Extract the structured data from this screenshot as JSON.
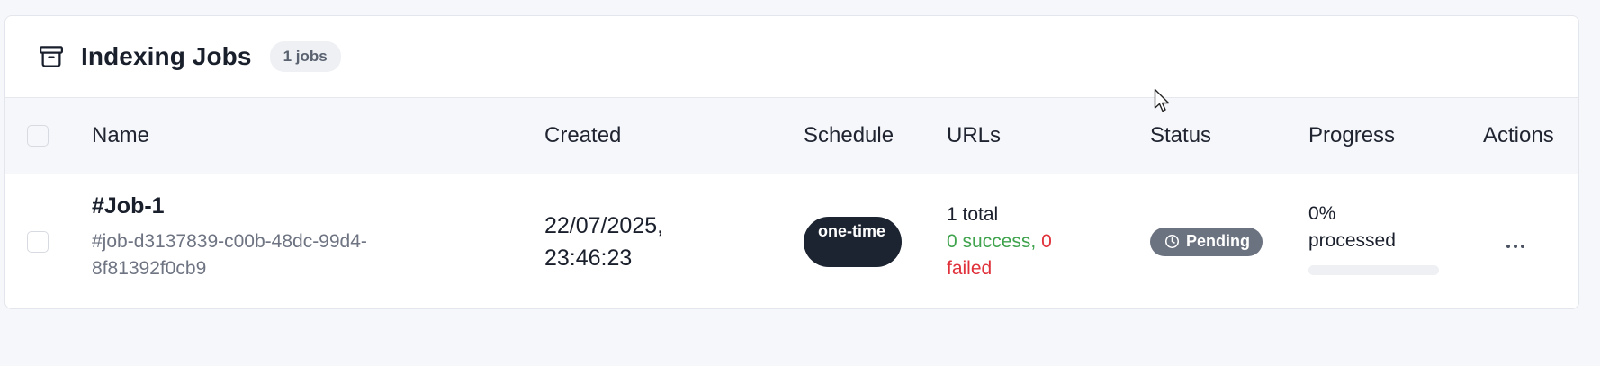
{
  "header": {
    "title": "Indexing Jobs",
    "count_badge": "1 jobs",
    "icon": "archive-icon"
  },
  "table": {
    "columns": [
      "Name",
      "Created",
      "Schedule",
      "URLs",
      "Status",
      "Progress",
      "Actions"
    ],
    "rows": [
      {
        "name": "#Job-1",
        "id": "#job-d3137839-c00b-48dc-99d4-8f81392f0cb9",
        "created": "22/07/2025, 23:46:23",
        "schedule": "one-time",
        "urls_total": "1 total",
        "urls_success": "0 success",
        "urls_separator": ",",
        "urls_failed": "0 failed",
        "status": "Pending",
        "status_icon": "clock-icon",
        "progress_text": "0% processed",
        "progress_fraction": 0,
        "actions_icon": "more-horizontal-icon"
      }
    ]
  },
  "colors": {
    "success": "#3fa34d",
    "failed": "#e0303a",
    "status_pending": "#6b7280",
    "schedule_pill": "#1c2431"
  }
}
